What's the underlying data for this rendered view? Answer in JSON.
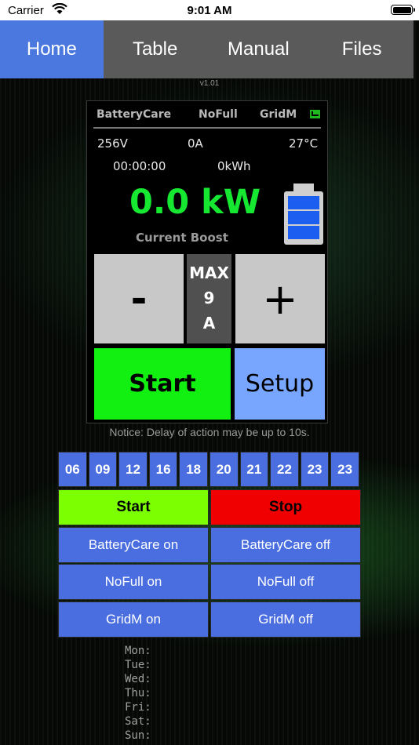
{
  "status_bar": {
    "carrier": "Carrier",
    "time": "9:01 AM"
  },
  "nav": {
    "tabs": [
      "Home",
      "Table",
      "Manual",
      "Files"
    ],
    "active": "Home"
  },
  "version": "v1.01",
  "display": {
    "mode1": "BatteryCare",
    "mode2": "NoFull",
    "mode3": "GridM",
    "voltage": "256V",
    "current": "0A",
    "temperature": "27°C",
    "duration": "00:00:00",
    "energy": "0kWh",
    "power": "0.0 kW",
    "power_label": "Current Boost",
    "battery_cells_filled": 3,
    "minus_label": "-",
    "plus_label": "+",
    "max_label": "MAX",
    "max_value": "9",
    "max_unit": "A",
    "start_label": "Start",
    "setup_label": "Setup"
  },
  "notice": "Notice: Delay of action may be up to 10s.",
  "schedule": {
    "hours": [
      "06",
      "09",
      "12",
      "16",
      "18",
      "20",
      "21",
      "22",
      "23",
      "23"
    ],
    "start_label": "Start",
    "stop_label": "Stop",
    "battery_on": "BatteryCare on",
    "battery_off": "BatteryCare off",
    "nofull_on": "NoFull on",
    "nofull_off": "NoFull off",
    "gridm_on": "GridM on",
    "gridm_off": "GridM off"
  },
  "days": [
    "Mon:",
    "Tue:",
    "Wed:",
    "Thu:",
    "Fri:",
    "Sat:",
    "Sun:"
  ],
  "colors": {
    "accent": "#4a78de",
    "power_green": "#16e832",
    "start_green": "#7cff00",
    "stop_red": "#f00000"
  }
}
